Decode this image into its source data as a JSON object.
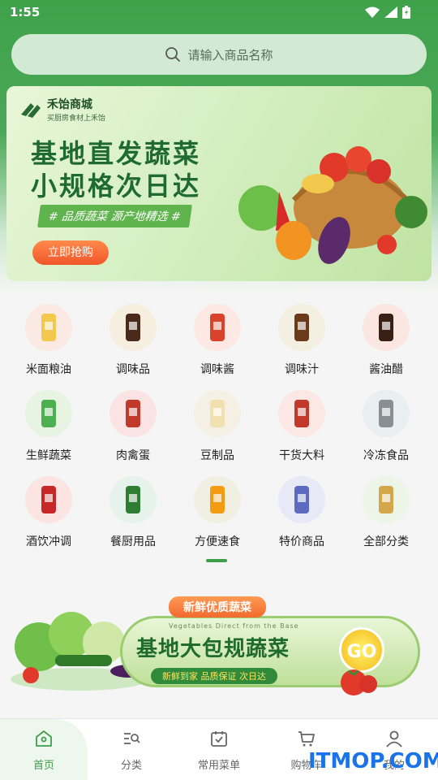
{
  "status_bar": {
    "time": "1:55"
  },
  "search": {
    "placeholder": "请输入商品名称"
  },
  "banner": {
    "brand_name": "禾饴商城",
    "brand_sub": "买厨房食材上禾饴",
    "headline_line1": "基地直发蔬菜",
    "headline_line2": "小规格次日达",
    "tagline": "# 品质蔬菜 源产地精选 #",
    "cta": "立即抢购"
  },
  "categories": [
    {
      "label": "米面粮油",
      "icon": "oil-icon"
    },
    {
      "label": "调味品",
      "icon": "seasoning-icon"
    },
    {
      "label": "调味酱",
      "icon": "sauce-icon"
    },
    {
      "label": "调味汁",
      "icon": "juice-icon"
    },
    {
      "label": "酱油醋",
      "icon": "soy-vinegar-icon"
    },
    {
      "label": "生鲜蔬菜",
      "icon": "vegetable-icon"
    },
    {
      "label": "肉禽蛋",
      "icon": "meat-icon"
    },
    {
      "label": "豆制品",
      "icon": "tofu-icon"
    },
    {
      "label": "干货大料",
      "icon": "spice-icon"
    },
    {
      "label": "冷冻食品",
      "icon": "frozen-fish-icon"
    },
    {
      "label": "酒饮冲调",
      "icon": "liquor-icon"
    },
    {
      "label": "餐厨用品",
      "icon": "kitchen-icon"
    },
    {
      "label": "方便速食",
      "icon": "instant-food-icon"
    },
    {
      "label": "特价商品",
      "icon": "discount-icon"
    },
    {
      "label": "全部分类",
      "icon": "all-categories-icon"
    }
  ],
  "promo": {
    "pill": "新鲜优质蔬菜",
    "en": "Vegetables Direct from the Base",
    "title": "基地大包规蔬菜",
    "subtitle": "新鲜到家 品质保证 次日达",
    "go": "GO"
  },
  "tabs": [
    {
      "label": "首页",
      "active": true
    },
    {
      "label": "分类",
      "active": false
    },
    {
      "label": "常用菜单",
      "active": false
    },
    {
      "label": "购物车",
      "active": false
    },
    {
      "label": "我的",
      "active": false
    }
  ],
  "watermark": "ITMOP.COM",
  "colors": {
    "primary": "#3f9e4a",
    "accent": "#f1562a"
  }
}
